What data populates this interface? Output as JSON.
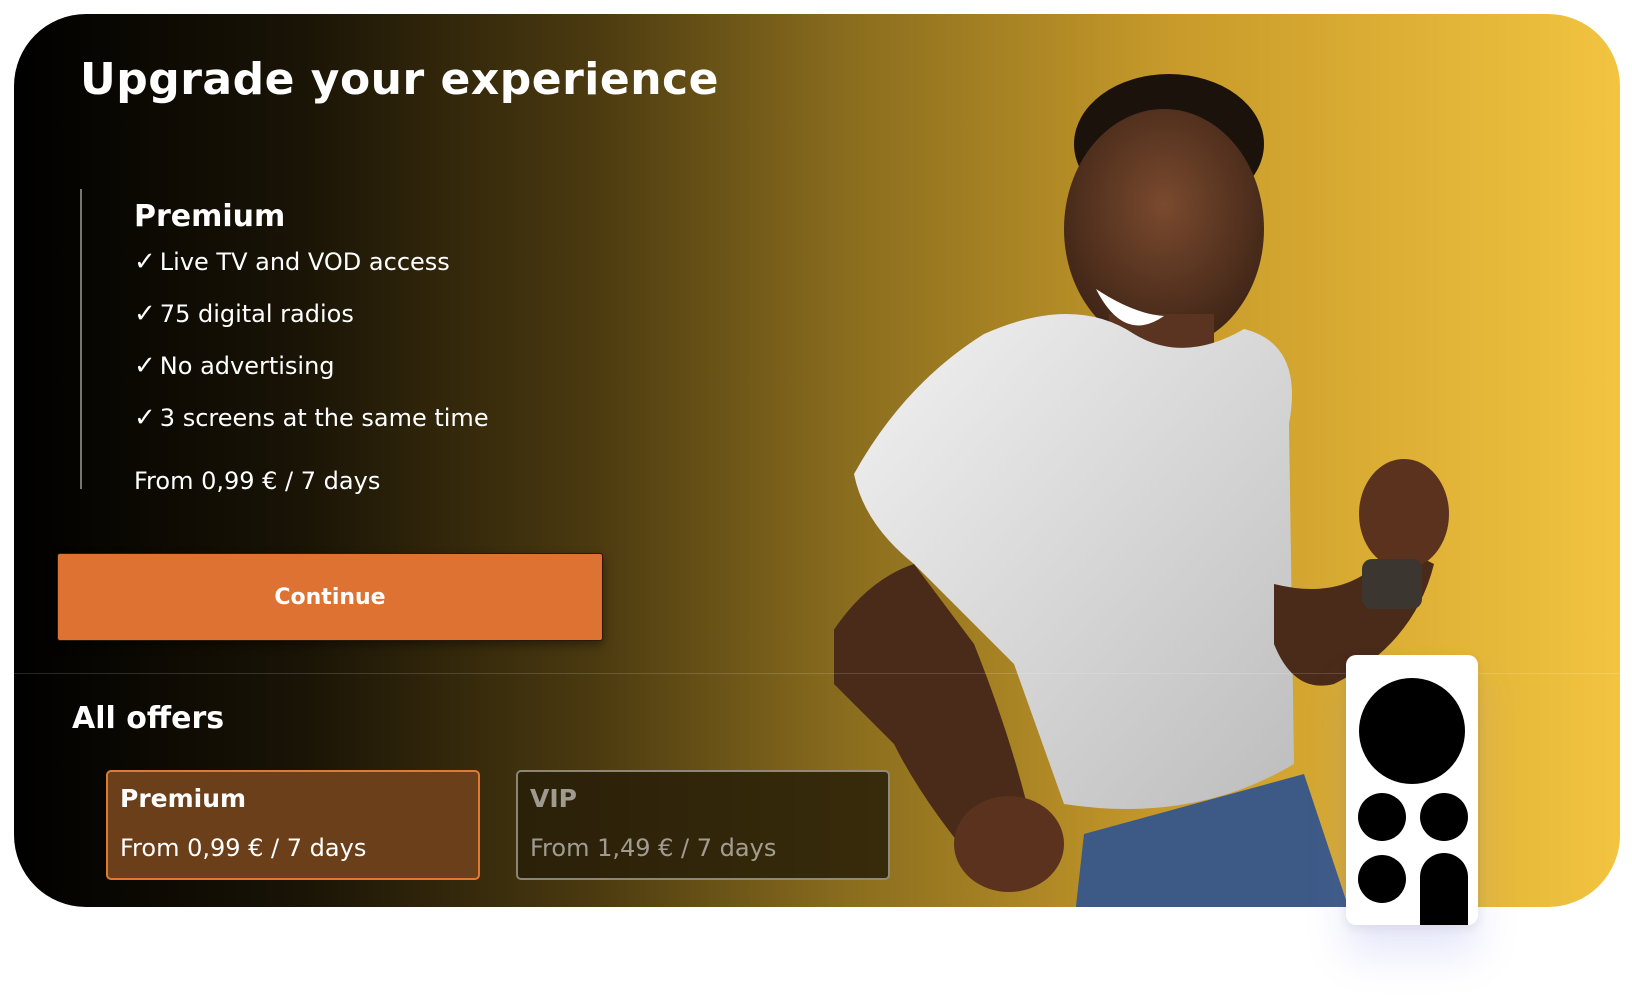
{
  "title": "Upgrade your experience",
  "plan": {
    "name": "Premium",
    "features": [
      "Live TV and VOD access",
      "75 digital radios",
      "No advertising",
      "3 screens at the same time"
    ],
    "check_glyph": "✓",
    "price": "From 0,99 € / 7 days"
  },
  "continue_label": "Continue",
  "offers": {
    "title": "All offers",
    "items": [
      {
        "name": "Premium",
        "price": "From 0,99 € / 7 days",
        "selected": true
      },
      {
        "name": "VIP",
        "price": "From 1,49 € / 7 days",
        "selected": false
      }
    ]
  },
  "colors": {
    "accent": "#dd7233",
    "gradient_start": "#000000",
    "gradient_end": "#f2c440"
  },
  "icons": {
    "remote": "remote-control-icon"
  }
}
